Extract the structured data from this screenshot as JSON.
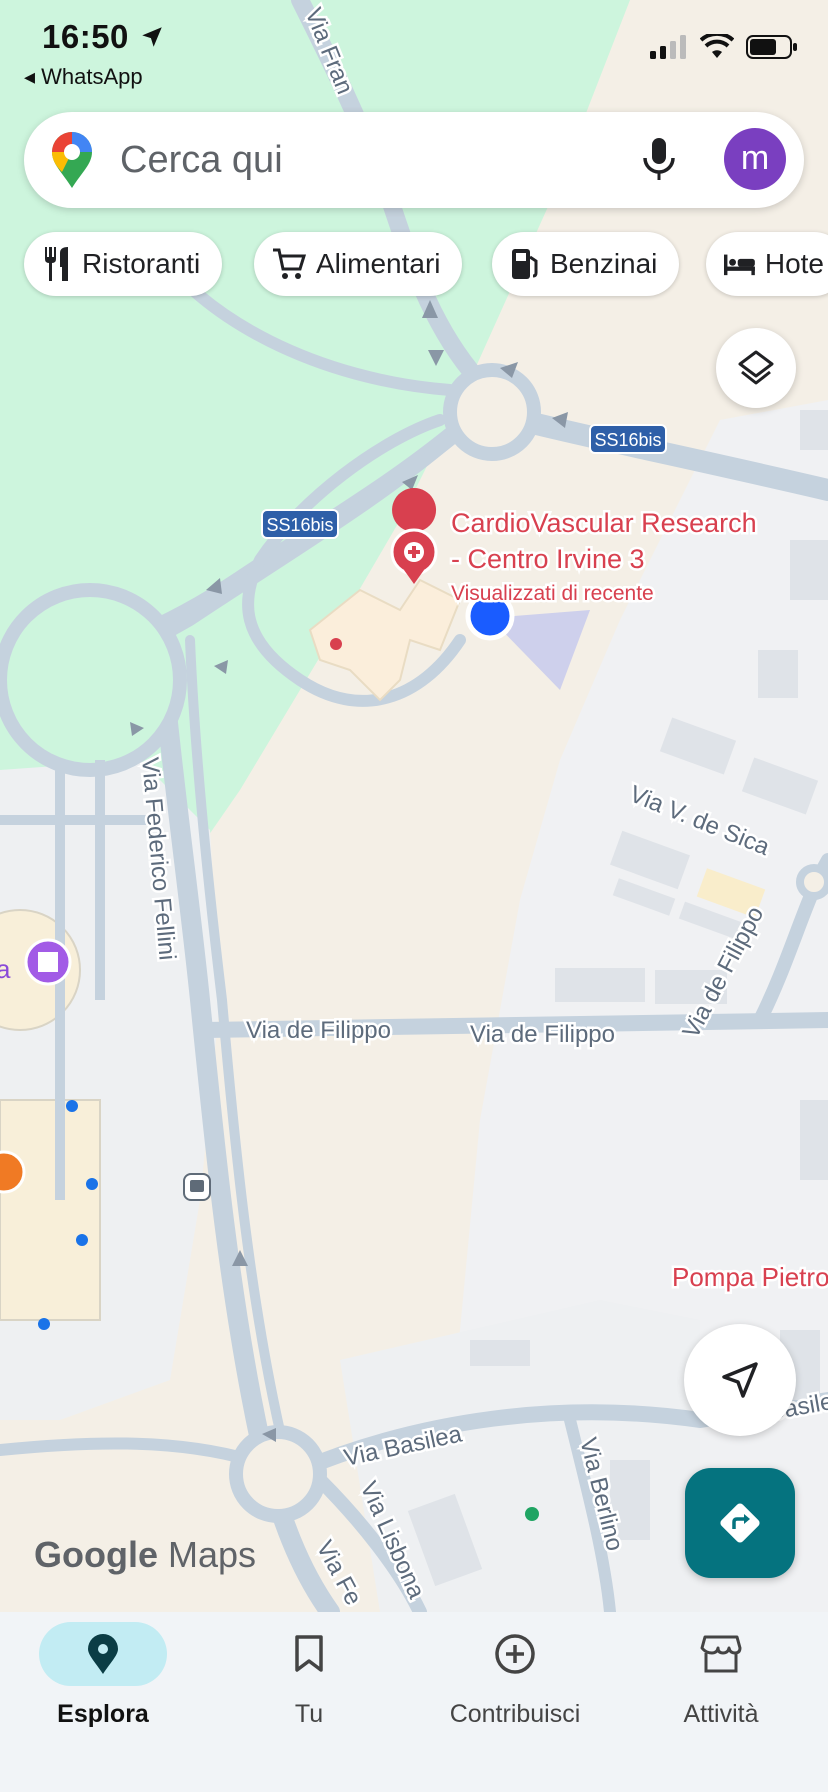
{
  "status_bar": {
    "time": "16:50",
    "back_app": "◂ WhatsApp"
  },
  "search": {
    "placeholder": "Cerca qui",
    "avatar_letter": "m"
  },
  "chips": [
    {
      "label": "Ristoranti",
      "icon": "fork-knife-icon"
    },
    {
      "label": "Alimentari",
      "icon": "cart-icon"
    },
    {
      "label": "Benzinai",
      "icon": "gas-pump-icon"
    },
    {
      "label": "Hote",
      "icon": "bed-icon"
    }
  ],
  "map": {
    "roads": {
      "via_fran": "Via Fran",
      "ss16bis_a": "SS16bis",
      "ss16bis_b": "SS16bis",
      "via_federico_fellini": "Via Federico Fellini",
      "via_de_filippo_1": "Via de Filippo",
      "via_de_filippo_2": "Via de Filippo",
      "via_de_filippo_3": "Via de Filippo",
      "via_v_de_sica": "Via V. de Sica",
      "via_basilea": "Via Basilea",
      "via_basile": "Basile",
      "via_berlino": "Via Berlino",
      "via_lisbona": "Via Lisbona",
      "via_fe": "Via Fe"
    },
    "place": {
      "name_line1": "CardioVascular Research",
      "name_line2": "- Centro Irvine 3",
      "subtitle": "Visualizzati di recente"
    },
    "pompa": "Pompa Pietro",
    "edge_label": "a"
  },
  "branding": {
    "google": "Google",
    "maps": "Maps"
  },
  "bottom_nav": [
    {
      "label": "Esplora",
      "icon": "location-pin-icon",
      "active": true
    },
    {
      "label": "Tu",
      "icon": "bookmark-icon",
      "active": false
    },
    {
      "label": "Contribuisci",
      "icon": "add-circle-icon",
      "active": false
    },
    {
      "label": "Attività",
      "icon": "store-icon",
      "active": false
    }
  ],
  "colors": {
    "park": "#cdf5dd",
    "land": "#f4efe6",
    "road": "#c5d2de",
    "directions_fab": "#05737f",
    "active_nav": "#c2ecf3",
    "place_red": "#d8404f",
    "my_location": "#1a5cff"
  }
}
